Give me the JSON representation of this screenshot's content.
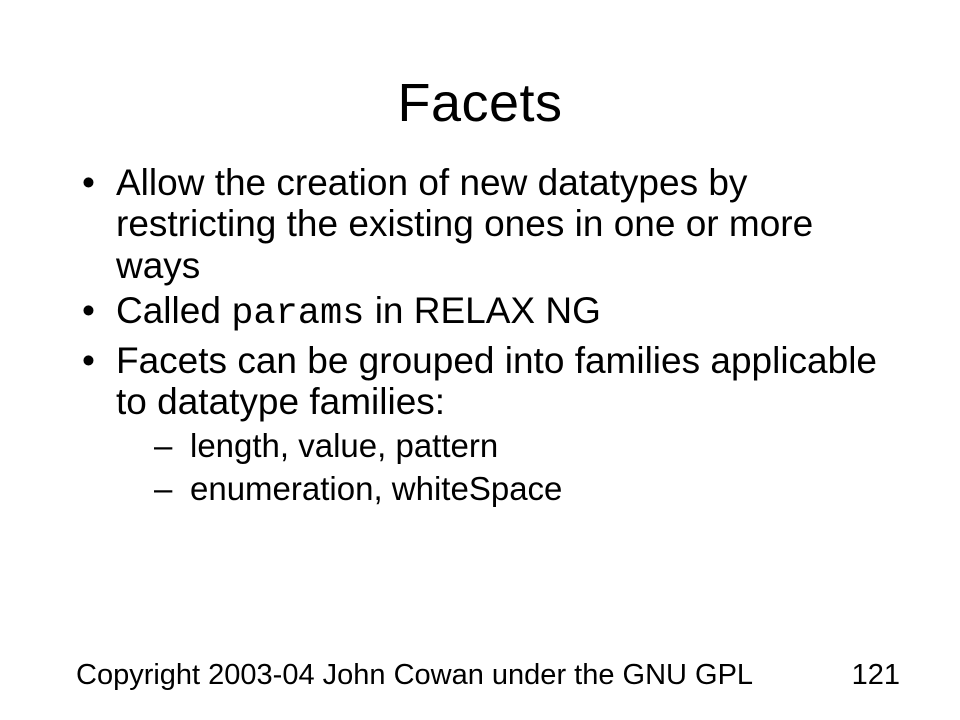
{
  "title": "Facets",
  "bullets": {
    "b1": "Allow the creation of new datatypes by restricting the existing ones in one or more ways",
    "b2_pre": "Called ",
    "b2_code": "params",
    "b2_post": " in RELAX NG",
    "b3": "Facets can be grouped into families applicable to datatype families:",
    "b3_sub1": "length, value, pattern",
    "b3_sub2": "enumeration, whiteSpace"
  },
  "footer": {
    "copyright": "Copyright 2003-04 John Cowan under the GNU GPL",
    "page": "121"
  }
}
